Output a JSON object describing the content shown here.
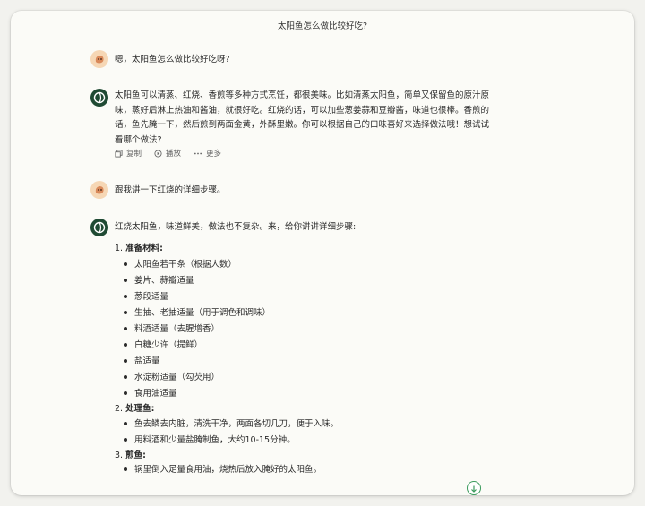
{
  "title": "太阳鱼怎么做比较好吃?",
  "messages": {
    "user1": "嗯，太阳鱼怎么做比较好吃呀?",
    "bot1": [
      "太阳鱼可以清蒸、红烧、香煎等多种方式烹饪，都很美味。比如清蒸太阳鱼，简单又保留鱼的原汁原",
      "味，蒸好后淋上热油和酱油，就很好吃。红烧的话，可以加些葱姜蒜和豆瓣酱，味道也很棒。香煎的",
      "话，鱼先腌一下，然后煎到两面金黄，外酥里嫩。你可以根据自己的口味喜好来选择做法哦！想试试",
      "看哪个做法?"
    ],
    "actions": {
      "copy": "复制",
      "play": "播放",
      "more": "更多"
    },
    "user2": "跟我讲一下红烧的详细步骤。",
    "bot2_intro": "红烧太阳鱼，味道鲜美，做法也不复杂。来，给你讲讲详细步骤:",
    "steps": [
      {
        "num": "1.",
        "title": "准备材料",
        "items": [
          "太阳鱼若干条（根据人数）",
          "姜片、蒜瓣适量",
          "葱段适量",
          "生抽、老抽适量（用于调色和调味）",
          "料酒适量（去腥增香）",
          "白糖少许（提鲜）",
          "盐适量",
          "水淀粉适量（勾芡用）",
          "食用油适量"
        ]
      },
      {
        "num": "2.",
        "title": "处理鱼",
        "items": [
          "鱼去鳞去内脏，清洗干净，两面各切几刀，便于入味。",
          "用料酒和少量盐腌制鱼，大约10-15分钟。"
        ]
      },
      {
        "num": "3.",
        "title": "煎鱼",
        "items": [
          "锅里倒入足量食用油，烧热后放入腌好的太阳鱼。"
        ]
      }
    ]
  },
  "icons": {
    "user_avatar": "user-avatar-icon",
    "bot_avatar": "bot-avatar-icon",
    "copy": "copy-icon",
    "play": "play-icon",
    "more": "more-icon",
    "scroll": "arrow-down-icon"
  },
  "colors": {
    "accent": "#3a9a5c",
    "bot": "#1f4a33",
    "user": "#f6d7b5"
  }
}
